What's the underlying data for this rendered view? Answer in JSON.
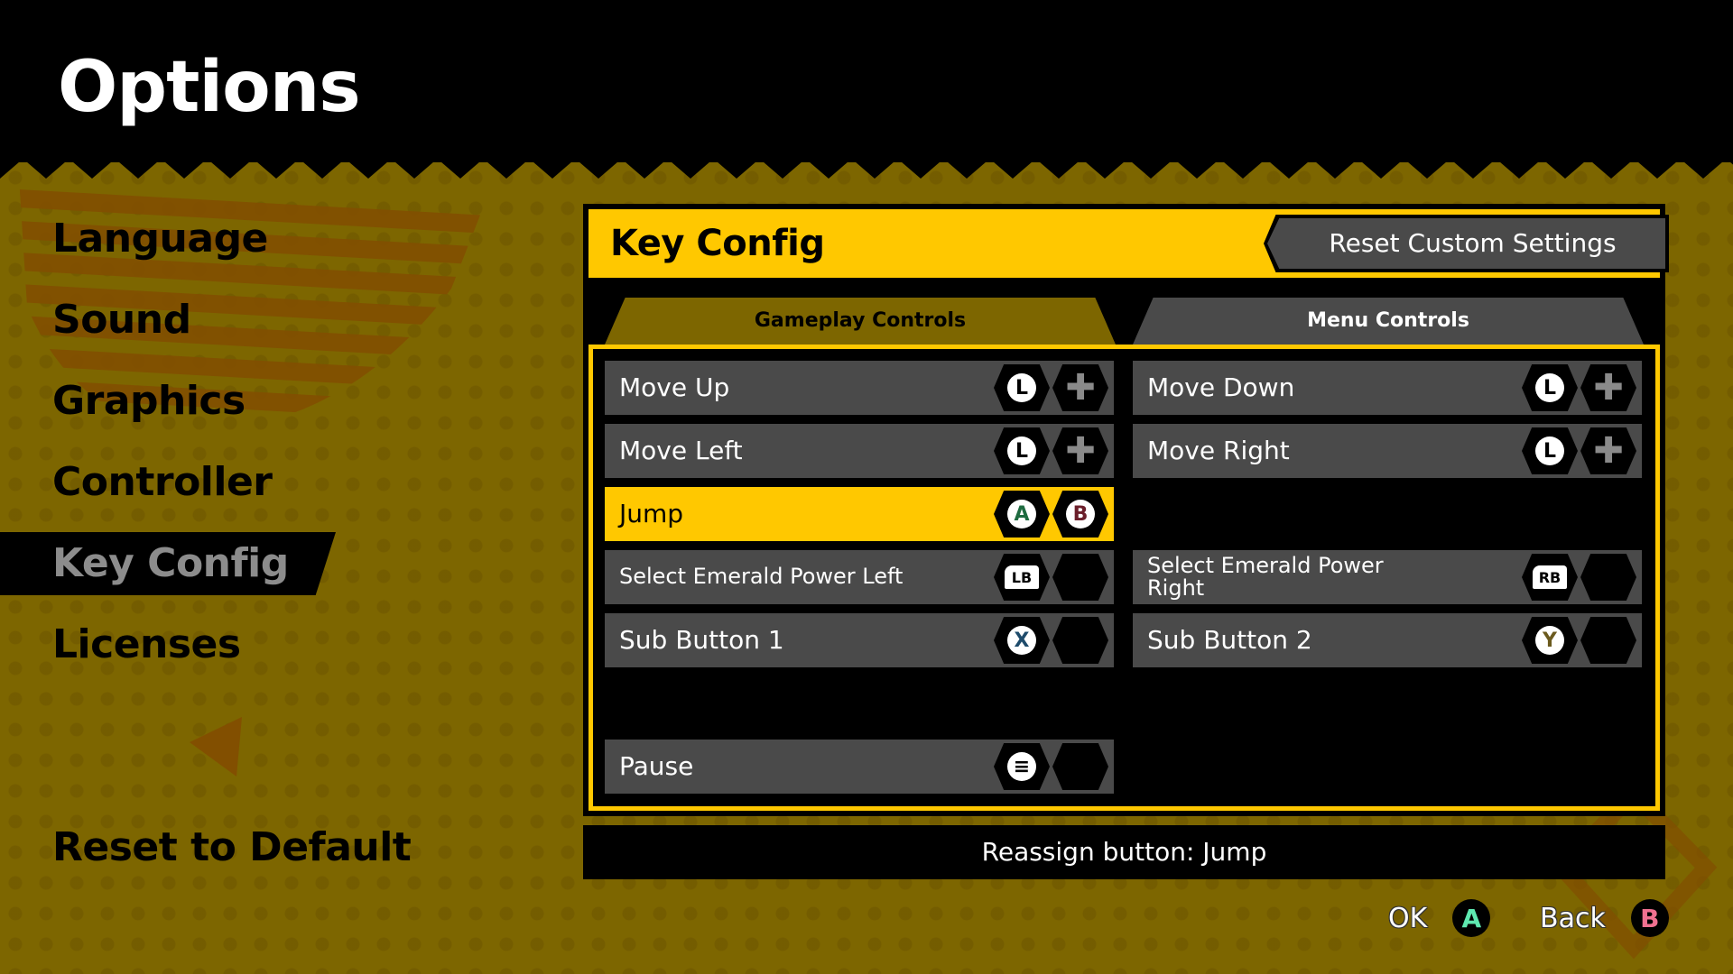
{
  "header": {
    "title": "Options"
  },
  "sidebar": {
    "items": [
      {
        "label": "Language",
        "active": false
      },
      {
        "label": "Sound",
        "active": false
      },
      {
        "label": "Graphics",
        "active": false
      },
      {
        "label": "Controller",
        "active": false
      },
      {
        "label": "Key Config",
        "active": true
      },
      {
        "label": "Licenses",
        "active": false
      }
    ],
    "reset_label": "Reset to Default"
  },
  "panel": {
    "title": "Key Config",
    "reset_button_label": "Reset Custom Settings",
    "tabs": [
      {
        "label": "Gameplay Controls",
        "active": true
      },
      {
        "label": "Menu Controls",
        "active": false
      }
    ],
    "left_rows": [
      {
        "label": "Move Up",
        "bind1": "L-stick-up",
        "bind1_glyph": "L",
        "bind2": "dpad-up",
        "selected": false
      },
      {
        "label": "Move Left",
        "bind1": "L-stick-left",
        "bind1_glyph": "L",
        "bind2": "dpad-left",
        "selected": false
      },
      {
        "label": "Jump",
        "bind1": "A",
        "bind1_glyph": "A",
        "bind2": "B",
        "bind2_glyph": "B",
        "selected": true
      },
      {
        "label": "Select Emerald Power Left",
        "bind1": "LB",
        "bind1_glyph": "LB",
        "bind2": "",
        "selected": false
      },
      {
        "label": "Sub Button 1",
        "bind1": "X",
        "bind1_glyph": "X",
        "bind2": "",
        "selected": false
      },
      {
        "label": "Pause",
        "bind1": "menu",
        "bind1_glyph": "≡",
        "bind2": "",
        "selected": false
      }
    ],
    "right_rows": [
      {
        "label": "Move Down",
        "bind1": "L-stick-down",
        "bind1_glyph": "L",
        "bind2": "dpad-down"
      },
      {
        "label": "Move Right",
        "bind1": "L-stick-right",
        "bind1_glyph": "L",
        "bind2": "dpad-right"
      },
      {
        "label": "Select Emerald Power Right",
        "bind1": "RB",
        "bind1_glyph": "RB",
        "bind2": ""
      },
      {
        "label": "Sub Button 2",
        "bind1": "Y",
        "bind1_glyph": "Y",
        "bind2": ""
      }
    ]
  },
  "info": {
    "text": "Reassign button: Jump"
  },
  "hints": [
    {
      "label": "OK",
      "button": "A",
      "color": "#5ee8b0"
    },
    {
      "label": "Back",
      "button": "B",
      "color": "#f07090"
    }
  ],
  "colors": {
    "accent": "#ffc800",
    "background": "#7d6600",
    "row": "#4a4a4a",
    "a_green": "#1e6b40",
    "b_maroon": "#6b1e2a",
    "x_blue": "#1e4b6b",
    "y_brown": "#6b5a1e"
  }
}
